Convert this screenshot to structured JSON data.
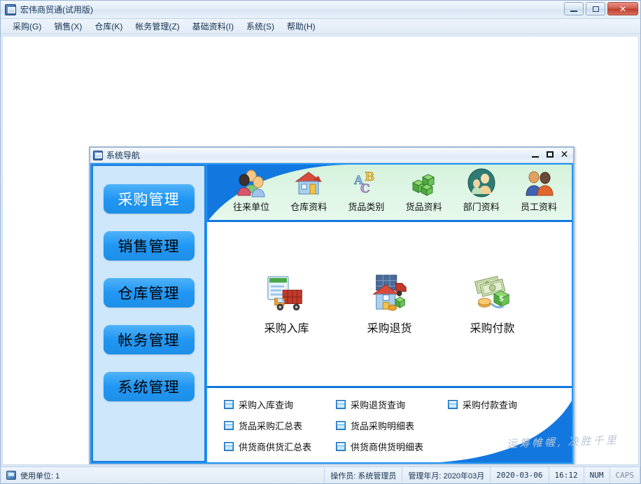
{
  "app": {
    "title": "宏伟商贸通(试用版)",
    "icon": "app-window-icon",
    "controls": {
      "minimize": "minimize-icon",
      "maximize": "maximize-icon",
      "close": "close-icon"
    }
  },
  "menubar": {
    "items": [
      {
        "label": "采购(G)"
      },
      {
        "label": "销售(X)"
      },
      {
        "label": "仓库(K)"
      },
      {
        "label": "帐务管理(Z)"
      },
      {
        "label": "基础资料(I)"
      },
      {
        "label": "系统(S)"
      },
      {
        "label": "帮助(H)"
      }
    ]
  },
  "child_window": {
    "title": "系统导航",
    "icon": "window-icon",
    "controls": {
      "minimize": "minimize-icon",
      "maximize": "maximize-icon",
      "close": "close-icon"
    }
  },
  "sidebar": {
    "items": [
      {
        "label": "采购管理",
        "active": true
      },
      {
        "label": "销售管理",
        "active": false
      },
      {
        "label": "仓库管理",
        "active": false
      },
      {
        "label": "帐务管理",
        "active": false
      },
      {
        "label": "系统管理",
        "active": false
      }
    ]
  },
  "top_toolbar": {
    "items": [
      {
        "label": "往来单位",
        "icon": "people-group-icon"
      },
      {
        "label": "仓库资料",
        "icon": "house-icon"
      },
      {
        "label": "货品类别",
        "icon": "abc-letters-icon"
      },
      {
        "label": "货品资料",
        "icon": "green-boxes-icon"
      },
      {
        "label": "部门资料",
        "icon": "department-people-icon"
      },
      {
        "label": "员工资料",
        "icon": "two-employees-icon"
      }
    ]
  },
  "main_actions": {
    "items": [
      {
        "label": "采购入库",
        "icon": "truck-inbound-icon"
      },
      {
        "label": "采购退货",
        "icon": "house-truck-return-icon"
      },
      {
        "label": "采购付款",
        "icon": "money-payment-icon"
      }
    ]
  },
  "reports": {
    "items": [
      {
        "label": "采购入库查询",
        "icon": "report-window-icon"
      },
      {
        "label": "采购退货查询",
        "icon": "report-window-icon"
      },
      {
        "label": "采购付款查询",
        "icon": "report-window-icon"
      },
      {
        "label": "货品采购汇总表",
        "icon": "report-window-icon"
      },
      {
        "label": "货品采购明细表",
        "icon": "report-window-icon"
      },
      {
        "label": "供货商供货汇总表",
        "icon": "report-window-icon"
      },
      {
        "label": "供货商供货明细表",
        "icon": "report-window-icon"
      }
    ]
  },
  "watermark": {
    "text": "运筹帷幄, 决胜千里"
  },
  "statusbar": {
    "unit": "使用单位: 1",
    "operator": "操作员: 系统管理员",
    "period": "管理年月: 2020年03月",
    "date": "2020-03-06",
    "time": "16:12",
    "num": "NUM",
    "caps": "CAPS"
  },
  "colors": {
    "accent_blue": "#2196f3",
    "divider_blue": "#1278e0",
    "band_green": "#d9f4e1",
    "sidebar_bg": "#cfe7fb"
  }
}
